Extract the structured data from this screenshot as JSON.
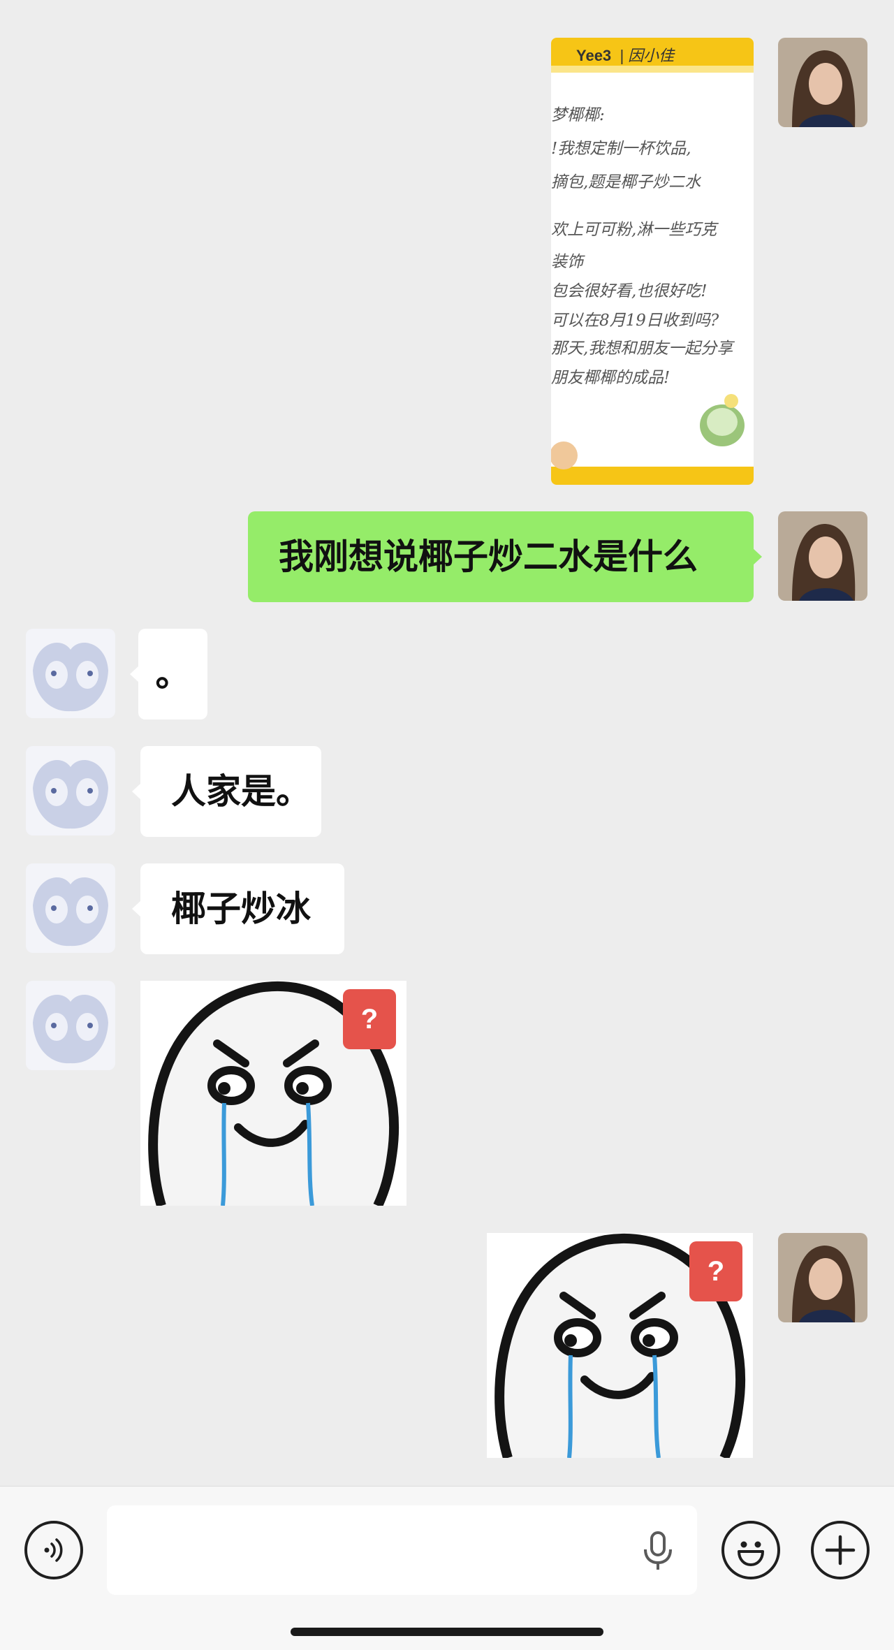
{
  "messages": [
    {
      "id": "m1",
      "side": "right",
      "type": "image",
      "content": "handwritten note image"
    },
    {
      "id": "m2",
      "side": "right",
      "type": "text",
      "text": "我刚想说椰子炒二水是什么"
    },
    {
      "id": "m3",
      "side": "left",
      "type": "text",
      "text": "。"
    },
    {
      "id": "m4",
      "side": "left",
      "type": "text",
      "text": "人家是。"
    },
    {
      "id": "m5",
      "side": "left",
      "type": "text",
      "text": "椰子炒冰"
    },
    {
      "id": "m6",
      "side": "left",
      "type": "sticker",
      "content": "crying-face-with-question-sticker"
    },
    {
      "id": "m7",
      "side": "right",
      "type": "sticker",
      "content": "crying-face-with-question-sticker"
    }
  ],
  "note": {
    "header_brand": "Yee3",
    "header_sub": "| 因小佳",
    "lines": [
      "梦椰椰:",
      "!我想定制一杯饮品,",
      "摘包,题是椰子炒二水",
      "欢上可可粉,淋一些巧克",
      "装饰",
      "包会很好看,也很好吃!",
      "可以在8月19日收到吗?",
      "那天,我想和朋友一起分享",
      "朋友椰椰的成品!"
    ]
  },
  "sticker": {
    "badge": "?"
  },
  "input": {
    "value": "",
    "placeholder": ""
  },
  "colors": {
    "background": "#ededed",
    "bubble_right": "#95ec69",
    "bubble_left": "#ffffff",
    "note_header": "#f6c516",
    "badge": "#e5534b"
  }
}
